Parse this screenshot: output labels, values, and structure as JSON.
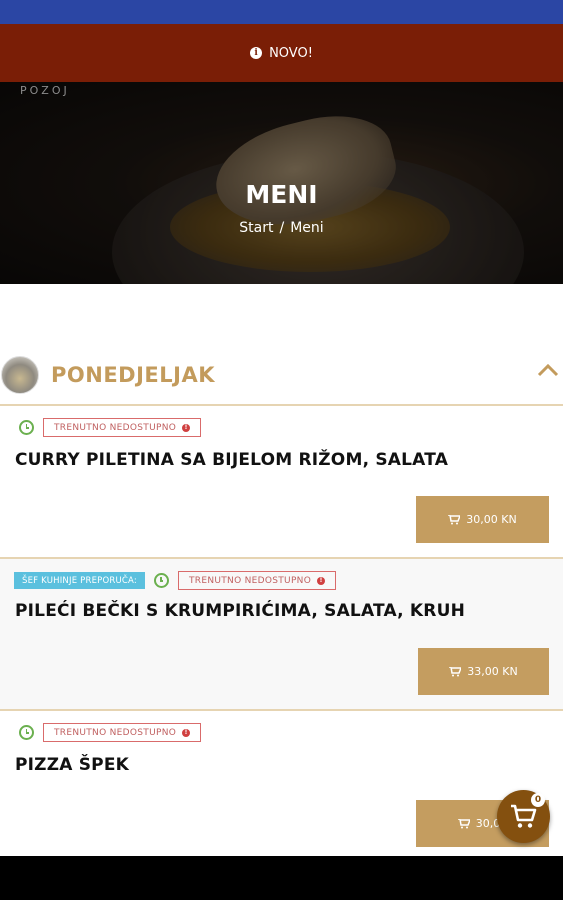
{
  "notice": {
    "label": "NOVO!",
    "icon": "info-icon"
  },
  "hero": {
    "brand": "POZOJ",
    "title": "MENI",
    "breadcrumb": [
      "Start",
      "Meni"
    ],
    "separator": "/"
  },
  "day": {
    "title": "PONEDJELJAK",
    "expanded": true
  },
  "items": [
    {
      "name": "CURRY PILETINA SA BIJELOM RIŽOM, SALATA",
      "chef_badge": "",
      "status": "TRENUTNO NEDOSTUPNO",
      "price": "30,00 KN"
    },
    {
      "name": "PILEĆI BEČKI S KRUMPIRIĆIMA, SALATA, KRUH",
      "chef_badge": "ŠEF KUHINJE PREPORUČA:",
      "status": "TRENUTNO NEDOSTUPNO",
      "price": "33,00 KN"
    },
    {
      "name": "PIZZA ŠPEK",
      "chef_badge": "",
      "status": "TRENUTNO NEDOSTUPNO",
      "price": "30,00"
    }
  ],
  "cart": {
    "count": "0"
  },
  "colors": {
    "accent": "#c49d60",
    "notice": "#7a1e06",
    "status_bar": "#2b46a4",
    "fab": "#84500f",
    "chef": "#5bc0de",
    "unavailable": "#d04040",
    "clock": "#6bb04f"
  }
}
